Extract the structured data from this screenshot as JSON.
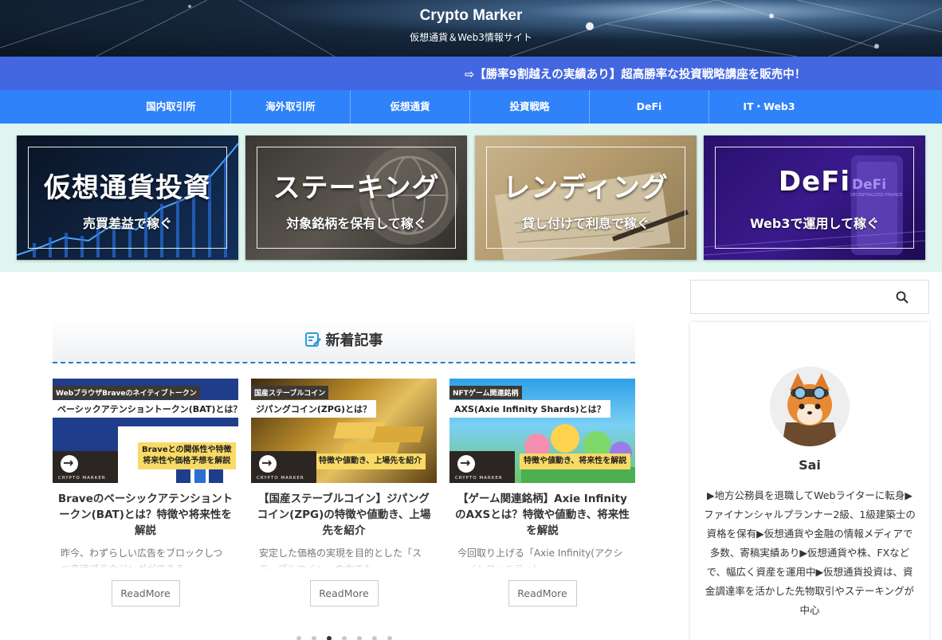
{
  "site": {
    "title": "Crypto Marker",
    "subtitle": "仮想通貨＆Web3情報サイト"
  },
  "notice": {
    "text": "⇨【勝率9割越えの実績あり】超高勝率な投資戦略講座を販売中！"
  },
  "nav": {
    "items": [
      "国内取引所",
      "海外取引所",
      "仮想通貨",
      "投資戦略",
      "DeFi",
      "IT・Web3"
    ]
  },
  "banners": [
    {
      "title": "仮想通貨投資",
      "sub": "売買差益で稼ぐ"
    },
    {
      "title": "ステーキング",
      "sub": "対象銘柄を保有して稼ぐ"
    },
    {
      "title": "レンディング",
      "sub": "貸し付けて利息で稼ぐ"
    },
    {
      "title": "DeFi",
      "sub": "Web3で運用して稼ぐ",
      "badge": "DeFi",
      "badge_sub": "DECENTRALIZED FINANCE"
    }
  ],
  "section": {
    "heading": "新着記事"
  },
  "cards": [
    {
      "tag": "WebブラウザBraveのネイティブトークン",
      "headline": "ベーシックアテンショントークン(BAT)とは？",
      "note": "Braveとの関係性や特徴\n将来性や価格予想を解説",
      "title": "Braveのベーシックアテンショントークン(BAT)とは？特徴や将来性を解説",
      "excerpt": "昨今、わずらしい広告をブロックしつつ高速ブラウジングができる",
      "readmore": "ReadMore"
    },
    {
      "tag": "国産ステーブルコイン",
      "headline": "ジパングコイン(ZPG)とは？",
      "note": "特徴や値動き、上場先を紹介",
      "title": "【国産ステーブルコイン】ジパングコイン(ZPG)の特徴や値動き、上場先を紹介",
      "excerpt": "安定した価格の実現を目的とした「ステーブルコイン」の中でも",
      "readmore": "ReadMore"
    },
    {
      "tag": "NFTゲーム関連銘柄",
      "headline": "AXS(Axie Infinity Shards)とは？",
      "note": "特徴や値動き、将来性を解説",
      "title": "【ゲーム関連銘柄】Axie InfinityのAXSとは？特徴や値動き、将来性を解説",
      "excerpt": "今回取り上げる「Axie Infinity(アクシーインフィニティ)」",
      "readmore": "ReadMore"
    }
  ],
  "thumb_brand": "CRYPTO MARKER",
  "carousel": {
    "count": 7,
    "active": 2
  },
  "search": {
    "placeholder": ""
  },
  "profile": {
    "name": "Sai",
    "bio": "▶地方公務員を退職してWebライターに転身▶ファイナンシャルプランナー2級、1級建築士の資格を保有▶仮想通貨や金融の情報メディアで多数、寄稿実績あり▶仮想通貨や株、FXなどで、幅広く資産を運用中▶仮想通貨投資は、資金調達率を活かした先物取引やステーキングが中心"
  },
  "colors": {
    "notice_bg": "#4267e0",
    "nav_bg": "#2f82fa",
    "banner_strip_bg": "#dff5f0",
    "accent_dash": "#2f78c4"
  }
}
